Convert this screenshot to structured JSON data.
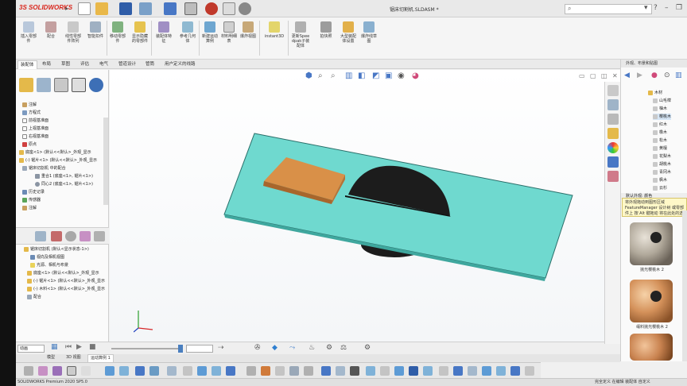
{
  "app": {
    "logo": "SOLIDWORKS",
    "document_title": "锯床切割机.SLDASM *",
    "status_text": "SOLIDWORKS Premium 2020 SP5.0",
    "status_right": "完全定义   在编辑 装配体   自定义"
  },
  "ribbon": {
    "buttons": [
      "插入零部件",
      "配合",
      "线性零部件阵列",
      "智能扣件",
      "移动零部件",
      "显示隐藏的零部件",
      "装配体特征",
      "参考几何体",
      "新建运动算例",
      "材料明细表",
      "爆炸视图",
      "instant3D",
      "更新Speedpak子装配体",
      "拍快照",
      "大型装配体设置",
      "爆炸线草图"
    ]
  },
  "tabs": [
    "装配体",
    "布局",
    "草图",
    "评估",
    "电气",
    "管道设计",
    "管筒",
    "用户定义的线路"
  ],
  "active_tab": 0,
  "feature_tree": {
    "items": [
      "注解",
      "方程式",
      "前视基准面",
      "上视基准面",
      "右视基准面",
      "原点",
      "底座<1> (默认<<默认>_外观_显示",
      "(-) 锯片<1> (默认<<默认>_外观_显示",
      "锯床切割机 中的配合",
      "重合1 (底座<1>, 锯片<1>)",
      "同心2 (底座<1>, 锯片<1>)",
      "历史记录",
      "传感器",
      "注解"
    ]
  },
  "motion_tree": {
    "items": [
      "锯床切割机 (默认<显示状态-1>)",
      "视向及相机视图",
      "光源、相机与布景",
      "底座<1> (默认<<默认>_外观_显示",
      "(-) 锯片<1> (默认<<默认>_外观_显示",
      "(-) 木料<1> (默认<<默认>_外观_显示",
      "配合"
    ]
  },
  "motion_bar": {
    "study_type": "动画",
    "tab_model": "模型",
    "tab_3d": "3D 视图",
    "tab_motion": "运动算例 1"
  },
  "right_panel": {
    "header": "外观、布景和贴图",
    "tree_items": [
      "木材",
      "山毛榉",
      "柚木",
      "樱桃木",
      "红木",
      "橡木",
      "松木",
      "黄檀",
      "花梨木",
      "胡桃木",
      "青冈木",
      "枫木",
      "云杉"
    ],
    "section_label": "默认外观: 颜色",
    "tooltip": "将外观拖动到图形区域 FeatureManager 设计树 或零部件上 按 Alt 键拖动 将在此处的选项运用",
    "swatches": [
      {
        "label": "抛光樱桃木 2"
      },
      {
        "label": "缎料抛光樱桃木 2"
      }
    ]
  },
  "colors": {
    "plate": "#6fd9cf",
    "plate_edge": "#2a6f6a",
    "wood": "#d99048",
    "blade": "#1c1c1c"
  }
}
